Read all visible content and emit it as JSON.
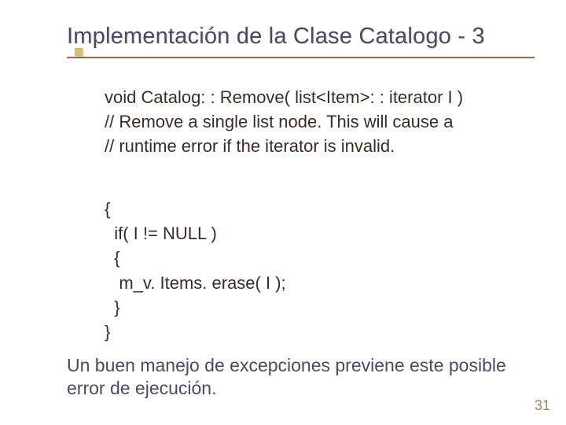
{
  "slide": {
    "title": "Implementación de la Clase Catalogo - 3",
    "code": {
      "line1": "void Catalog: : Remove( list<Item>: : iterator I )",
      "line2": "// Remove a single list node. This will cause a",
      "line3": "// runtime error if the iterator is invalid."
    },
    "body": {
      "l1": "{",
      "l2": "  if( I != NULL )",
      "l3": "  {",
      "l4": "   m_v. Items. erase( I );",
      "l5": "  }",
      "l6": "}"
    },
    "footer": "Un buen manejo de excepciones previene este posible error de ejecución.",
    "page_number": "31"
  }
}
